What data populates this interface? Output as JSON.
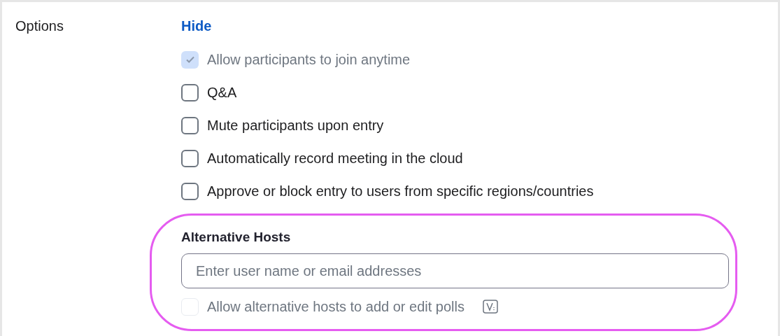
{
  "section_label": "Options",
  "toggle_link": "Hide",
  "options": [
    {
      "label": "Allow participants to join anytime",
      "checked": true,
      "disabled": true
    },
    {
      "label": "Q&A",
      "checked": false,
      "disabled": false
    },
    {
      "label": "Mute participants upon entry",
      "checked": false,
      "disabled": false
    },
    {
      "label": "Automatically record meeting in the cloud",
      "checked": false,
      "disabled": false
    },
    {
      "label": "Approve or block entry to users from specific regions/countries",
      "checked": false,
      "disabled": false
    }
  ],
  "alternative_hosts": {
    "title": "Alternative Hosts",
    "placeholder": "Enter user name or email addresses",
    "option": {
      "label": "Allow alternative hosts to add or edit polls",
      "checked": false,
      "disabled": true
    }
  }
}
